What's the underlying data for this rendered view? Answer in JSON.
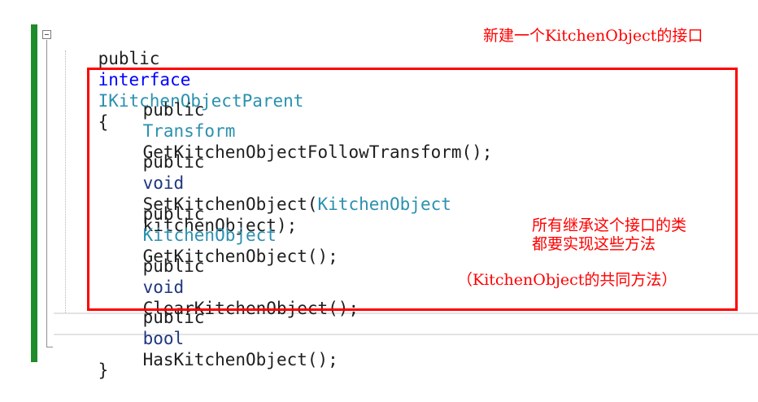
{
  "code": {
    "line1": {
      "kw_public": "public",
      "kw_interface": "interface",
      "name": "IKitchenObjectParent",
      "brace": "{"
    },
    "line2": {
      "kw_public": "public",
      "type": "Transform",
      "rest": "GetKitchenObjectFollowTransform();"
    },
    "line3": {
      "kw_public": "public",
      "kw_void": "void",
      "method": "SetKitchenObject(",
      "param_type": "KitchenObject",
      "rest": "kitchenObject);"
    },
    "line4": {
      "kw_public": "public",
      "type": "KitchenObject",
      "rest": "GetKitchenObject();"
    },
    "line5": {
      "kw_public": "public",
      "kw_void": "void",
      "rest": "ClearKitchenObject();"
    },
    "line6": {
      "kw_public": "public",
      "kw_bool": "bool",
      "rest": "HasKitchenObject();"
    },
    "closing": "}"
  },
  "annotations": {
    "top_note": "新建一个KitchenObject的接口",
    "side_note_line1": "所有继承这个接口的类",
    "side_note_line2": "都要实现这些方法",
    "bottom_note": "（KitchenObject的共同方法）"
  },
  "colors": {
    "keyword": "#0000ff",
    "type": "#2b91af",
    "annotation": "#ff0000",
    "change_bar": "#1f8c2c"
  }
}
